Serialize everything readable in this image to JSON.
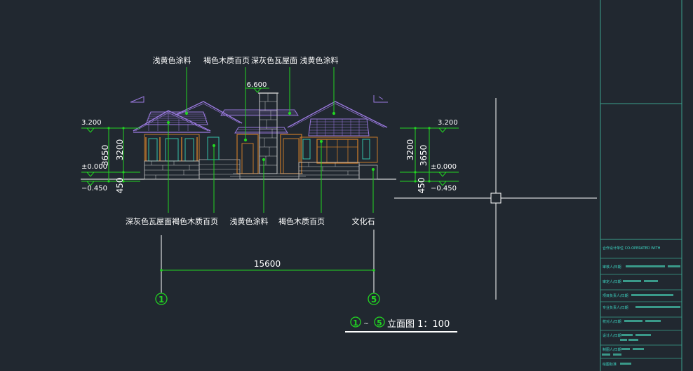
{
  "colors": {
    "background": "#212830",
    "leader": "#22d422",
    "text": "#ffffff",
    "dimension": "#ffffff",
    "roof": "#9b7ae0",
    "wall": "#c87a2a",
    "stone": "#c8c8c8",
    "window": "#35c0a8",
    "frame": "#3aa08c",
    "title_text": "#3dd6c4"
  },
  "elevation": {
    "ridge_level": "6.600",
    "dims_left": {
      "eave": "3.200",
      "zero": "±0.000",
      "ground": "−0.450",
      "d1": "3650",
      "d2": "3200",
      "d3": "450"
    },
    "dims_right": {
      "eave": "3.200",
      "zero": "±0.000",
      "ground": "−0.450",
      "d1": "3650",
      "d2": "3200",
      "d3": "450"
    },
    "labels_top": [
      "浅黄色涂料",
      "褐色木质百页",
      "深灰色瓦屋面",
      "浅黄色涂料"
    ],
    "labels_bottom": [
      "深灰色瓦屋面",
      "褐色木质百页",
      "浅黄色涂料",
      "褐色木质百页",
      "文化石"
    ],
    "overall_width": "15600",
    "axis_start": "1",
    "axis_end": "5"
  },
  "drawing_title": {
    "from": "1",
    "sep": "~",
    "to": "5",
    "text": "立面图  1：100"
  },
  "title_block": {
    "header": "合作设计单位   CO-OPERATED WITH",
    "rows": [
      "审核人/日期",
      "审定人/日期",
      "项目负责人/日期",
      "专业负责人/日期",
      "校对人/日期",
      "设计人/日期",
      "制图人/日期",
      "绘图标准"
    ]
  }
}
